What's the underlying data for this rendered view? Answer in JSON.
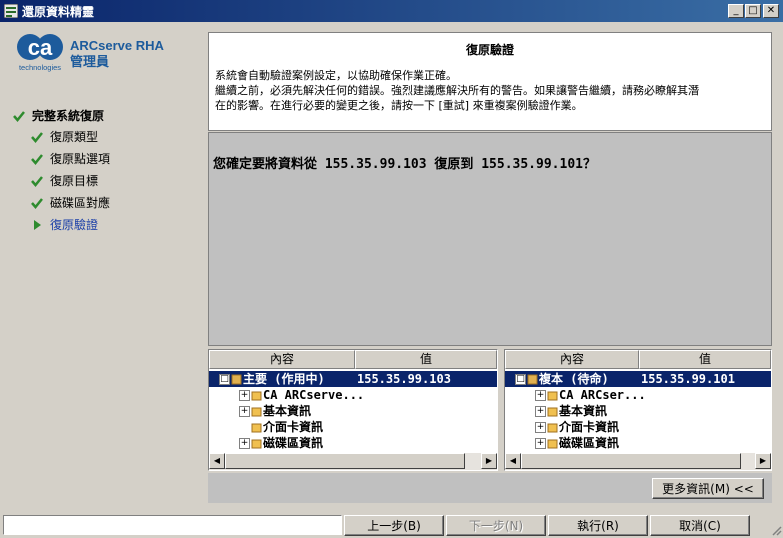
{
  "window": {
    "title": "還原資料精靈",
    "minimize_glyph": "_",
    "maximize_glyph": "□",
    "close_glyph": "✕"
  },
  "branding": {
    "logo_text": "ca",
    "logo_subtext": "technologies",
    "app_name_line1": "ARCserve RHA",
    "app_name_line2": "管理員"
  },
  "steps": [
    {
      "label": "完整系統復原",
      "icon": "check-icon",
      "state": "done",
      "bold": true
    },
    {
      "label": "復原類型",
      "icon": "check-icon",
      "state": "done"
    },
    {
      "label": "復原點選項",
      "icon": "check-icon",
      "state": "done"
    },
    {
      "label": "復原目標",
      "icon": "check-icon",
      "state": "done"
    },
    {
      "label": "磁碟區對應",
      "icon": "check-icon",
      "state": "done"
    },
    {
      "label": "復原驗證",
      "icon": "arrow-right-icon",
      "state": "current"
    }
  ],
  "header": {
    "title": "復原驗證",
    "line1": "系統會自動驗證案例設定，以協助確保作業正確。",
    "line2": "繼續之前，必須先解決任何的錯誤。強烈建議應解決所有的警告。如果讓警告繼續，請務必瞭解其潛",
    "line3": "在的影響。在進行必要的變更之後，請按一下 [重試] 來重複案例驗證作業。"
  },
  "question": "您確定要將資料從 155.35.99.103 復原到 155.35.99.101？",
  "tables": {
    "col_content": "內容",
    "col_value": "值",
    "left": {
      "rows": [
        {
          "label": "主要 (作用中)",
          "value": "155.35.99.103",
          "selected": true,
          "expander": "□"
        },
        {
          "label": "CA ARCserve...",
          "value": "",
          "expander": "+"
        },
        {
          "label": "基本資訊",
          "value": "",
          "expander": "+"
        },
        {
          "label": "介面卡資訊",
          "value": "",
          "expander": ""
        },
        {
          "label": "磁碟區資訊",
          "value": "",
          "expander": "+"
        }
      ]
    },
    "right": {
      "rows": [
        {
          "label": "複本 (待命)",
          "value": "155.35.99.101",
          "selected": true,
          "expander": "□"
        },
        {
          "label": "CA ARCser...",
          "value": "",
          "expander": "+"
        },
        {
          "label": "基本資訊",
          "value": "",
          "expander": "+"
        },
        {
          "label": "介面卡資訊",
          "value": "",
          "expander": "+"
        },
        {
          "label": "磁碟區資訊",
          "value": "",
          "expander": "+"
        }
      ]
    }
  },
  "buttons": {
    "more_info": "更多資訊(M) <<",
    "back": "上一步(B)",
    "next": "下一步(N)",
    "run": "執行(R)",
    "cancel": "取消(C)"
  },
  "colors": {
    "titlebar_start": "#0a246a",
    "brand_blue": "#1d5b9c",
    "check_green": "#2e8b2e",
    "current_step": "#1b3fa8"
  }
}
